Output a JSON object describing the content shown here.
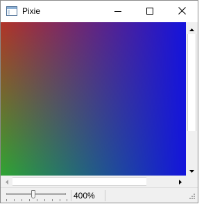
{
  "window": {
    "title": "Pixie",
    "icon": "app-window-icon",
    "controls": [
      "minimize-icon",
      "maximize-icon",
      "close-icon"
    ]
  },
  "canvas": {
    "colors": {
      "top_left": "#b23427",
      "bottom_left": "#2fa532",
      "right": "#1414dc"
    }
  },
  "statusbar": {
    "zoom_text": "400%",
    "zoom_slider_level": 0.45
  }
}
